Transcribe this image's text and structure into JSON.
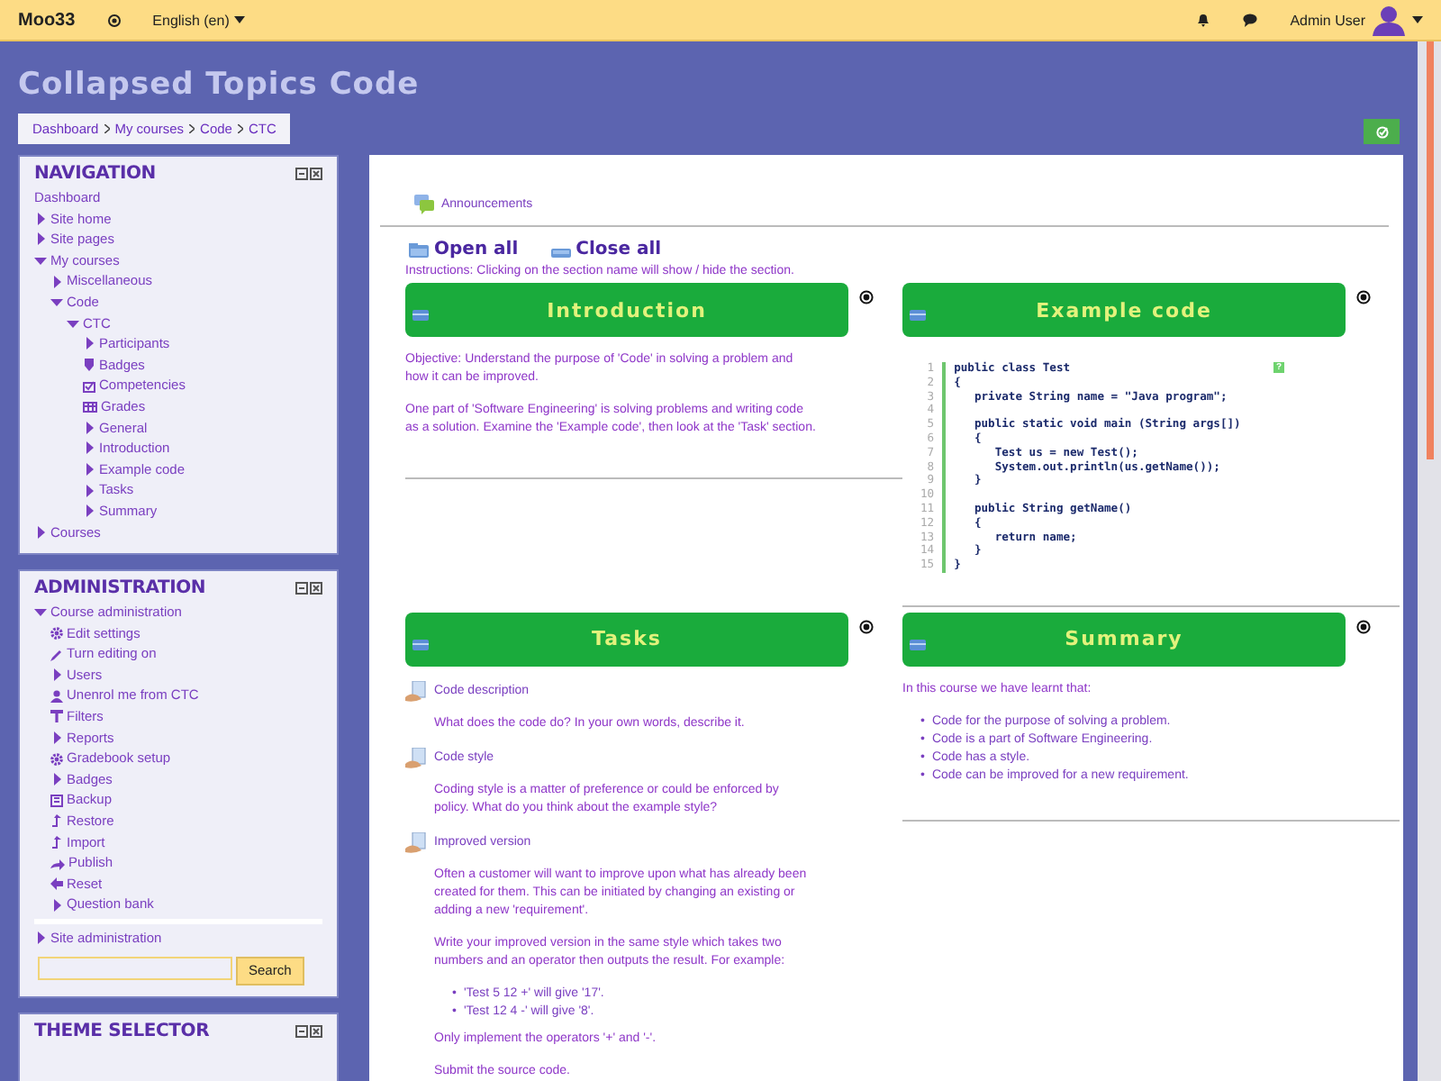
{
  "topbar": {
    "brand": "Moo33",
    "language": "English (en)",
    "user": "Admin User"
  },
  "page_title": "Collapsed Topics Code",
  "breadcrumb": [
    "Dashboard",
    "My courses",
    "Code",
    "CTC"
  ],
  "navigation": {
    "title": "NAVIGATION",
    "items": [
      {
        "label": "Dashboard",
        "kind": "plain"
      },
      {
        "label": "Site home",
        "kind": "branch",
        "expanded": false
      },
      {
        "label": "Site pages",
        "kind": "branch",
        "expanded": false
      },
      {
        "label": "My courses",
        "kind": "branch",
        "expanded": true,
        "children": [
          {
            "label": "Miscellaneous",
            "kind": "branch",
            "expanded": false
          },
          {
            "label": "Code",
            "kind": "branch",
            "expanded": true,
            "children": [
              {
                "label": "CTC",
                "kind": "branch",
                "expanded": true,
                "children": [
                  {
                    "label": "Participants",
                    "kind": "branch",
                    "expanded": false
                  },
                  {
                    "label": "Badges",
                    "kind": "badge"
                  },
                  {
                    "label": "Competencies",
                    "kind": "competency"
                  },
                  {
                    "label": "Grades",
                    "kind": "grades"
                  },
                  {
                    "label": "General",
                    "kind": "branch",
                    "expanded": false
                  },
                  {
                    "label": "Introduction",
                    "kind": "branch",
                    "expanded": false
                  },
                  {
                    "label": "Example code",
                    "kind": "branch",
                    "expanded": false
                  },
                  {
                    "label": "Tasks",
                    "kind": "branch",
                    "expanded": false
                  },
                  {
                    "label": "Summary",
                    "kind": "branch",
                    "expanded": false
                  }
                ]
              }
            ]
          }
        ]
      },
      {
        "label": "Courses",
        "kind": "branch",
        "expanded": false
      }
    ]
  },
  "administration": {
    "title": "ADMINISTRATION",
    "items": [
      {
        "label": "Course administration",
        "kind": "branch",
        "expanded": true,
        "children": [
          {
            "label": "Edit settings",
            "kind": "gear"
          },
          {
            "label": "Turn editing on",
            "kind": "pencil"
          },
          {
            "label": "Users",
            "kind": "branch",
            "expanded": false
          },
          {
            "label": "Unenrol me from CTC",
            "kind": "person"
          },
          {
            "label": "Filters",
            "kind": "filter"
          },
          {
            "label": "Reports",
            "kind": "branch",
            "expanded": false
          },
          {
            "label": "Gradebook setup",
            "kind": "gear"
          },
          {
            "label": "Badges",
            "kind": "branch",
            "expanded": false
          },
          {
            "label": "Backup",
            "kind": "backup"
          },
          {
            "label": "Restore",
            "kind": "upload"
          },
          {
            "label": "Import",
            "kind": "upload"
          },
          {
            "label": "Publish",
            "kind": "share"
          },
          {
            "label": "Reset",
            "kind": "back"
          },
          {
            "label": "Question bank",
            "kind": "branch",
            "expanded": false
          }
        ]
      }
    ],
    "site_item": {
      "label": "Site administration",
      "kind": "branch",
      "expanded": false
    },
    "search_button": "Search"
  },
  "theme_selector": {
    "title": "THEME SELECTOR"
  },
  "announcements": "Announcements",
  "open_all": "Open all",
  "close_all": "Close all",
  "instructions": "Instructions: Clicking on the section name will show / hide the section.",
  "sections": [
    {
      "title": "Introduction",
      "content": [
        {
          "kind": "paragraph",
          "text": "Objective: Understand the purpose of 'Code' in solving a problem and how it can be improved."
        },
        {
          "kind": "paragraph",
          "text": "One part of 'Software Engineering' is solving problems and writing code as a solution.  Examine the 'Example code', then look at the 'Task' section."
        }
      ]
    },
    {
      "title": "Example code",
      "content": [
        {
          "kind": "code",
          "help": "?",
          "lines": [
            {
              "number": "1",
              "text": "public class Test"
            },
            {
              "number": "2",
              "text": "{"
            },
            {
              "number": "3",
              "text": "   private String name = \"Java program\";"
            },
            {
              "number": "4"
            },
            {
              "number": "5",
              "text": "   public static void main (String args[])"
            },
            {
              "number": "6",
              "text": "   {"
            },
            {
              "number": "7",
              "text": "      Test us = new Test();"
            },
            {
              "number": "8",
              "text": "      System.out.println(us.getName());"
            },
            {
              "number": "9",
              "text": "   }"
            },
            {
              "number": "10"
            },
            {
              "number": "11",
              "text": "   public String getName()"
            },
            {
              "number": "12",
              "text": "   {"
            },
            {
              "number": "13",
              "text": "      return name;"
            },
            {
              "number": "14",
              "text": "   }"
            },
            {
              "number": "15",
              "text": "}"
            }
          ]
        }
      ]
    },
    {
      "title": "Tasks",
      "content": [
        {
          "kind": "activity",
          "name": "Code description",
          "details": [
            {
              "kind": "paragraph",
              "text": "What does the code do?  In your own words, describe it."
            }
          ]
        },
        {
          "kind": "activity",
          "name": "Code style",
          "details": [
            {
              "kind": "paragraph",
              "text": "Coding style is a matter of preference or could be enforced by policy.  What do you think about the example style?"
            }
          ]
        },
        {
          "kind": "activity",
          "name": "Improved version",
          "details": [
            {
              "kind": "paragraph",
              "text": "Often a customer will want to improve upon what has already been created for them.  This can be initiated by changing an existing or adding a new 'requirement'."
            },
            {
              "kind": "paragraph",
              "text": "Write your improved version in the same style which takes two numbers and an operator then outputs the result.  For example:"
            },
            {
              "kind": "list",
              "items": [
                {
                  "marker": "•",
                  "text": "'Test 5 12 +' will give '17'."
                },
                {
                  "marker": "•",
                  "text": "'Test 12 4 -' will give '8'."
                }
              ]
            },
            {
              "kind": "paragraph",
              "text": "Only implement the operators '+' and '-'."
            },
            {
              "kind": "paragraph",
              "text": "Submit the source code."
            }
          ]
        }
      ]
    },
    {
      "title": "Summary",
      "content": [
        {
          "kind": "paragraph",
          "text": "In this course we have learnt that:"
        },
        {
          "kind": "list",
          "items": [
            {
              "marker": "•",
              "text": "Code for the purpose of solving a problem."
            },
            {
              "marker": "•",
              "text": "Code is a part of Software Engineering."
            },
            {
              "marker": "•",
              "text": "Code has a style."
            },
            {
              "marker": "•",
              "text": "Code can be improved for a new requirement."
            }
          ]
        }
      ]
    }
  ]
}
